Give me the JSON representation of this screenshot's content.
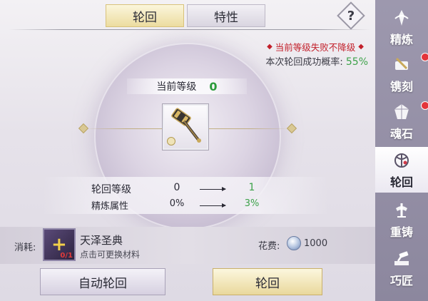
{
  "tabs": [
    {
      "label": "轮回",
      "active": true
    },
    {
      "label": "特性",
      "active": false
    }
  ],
  "help_icon": "?",
  "warning": {
    "text": "当前等级失败不降级",
    "marker": "◆"
  },
  "success_rate": {
    "label": "本次轮回成功概率:",
    "value": "55%"
  },
  "current_level": {
    "label": "当前等级",
    "value": "0"
  },
  "item": {
    "icon": "hammer-icon",
    "badge_icon": "lock-icon"
  },
  "stats": [
    {
      "label": "轮回等级",
      "from": "0",
      "to": "1"
    },
    {
      "label": "精炼属性",
      "from": "0%",
      "to": "3%"
    }
  ],
  "cost": {
    "label": "消耗:",
    "material_name": "天泽圣典",
    "material_hint": "点击可更换材料",
    "material_count": "0/1",
    "fee_label": "花费:",
    "fee_amount": "1000"
  },
  "buttons": {
    "auto": "自动轮回",
    "main": "轮回"
  },
  "sidebar": [
    {
      "label": "精炼",
      "icon": "refine-icon",
      "active": false,
      "dot": true
    },
    {
      "label": "镌刻",
      "icon": "engrave-icon",
      "active": false,
      "dot": true
    },
    {
      "label": "魂石",
      "icon": "soulstone-icon",
      "active": false,
      "dot": false
    },
    {
      "label": "轮回",
      "icon": "reincarnate-icon",
      "active": true,
      "dot": false
    },
    {
      "label": "重铸",
      "icon": "reforge-icon",
      "active": false,
      "dot": false
    },
    {
      "label": "巧匠",
      "icon": "craftsman-icon",
      "active": false,
      "dot": false
    }
  ],
  "colors": {
    "success_green": "#3da24a",
    "warning_red": "#c21f2a",
    "gold_button": "#e9d89c",
    "sidebar_bg": "#9d98ae"
  }
}
